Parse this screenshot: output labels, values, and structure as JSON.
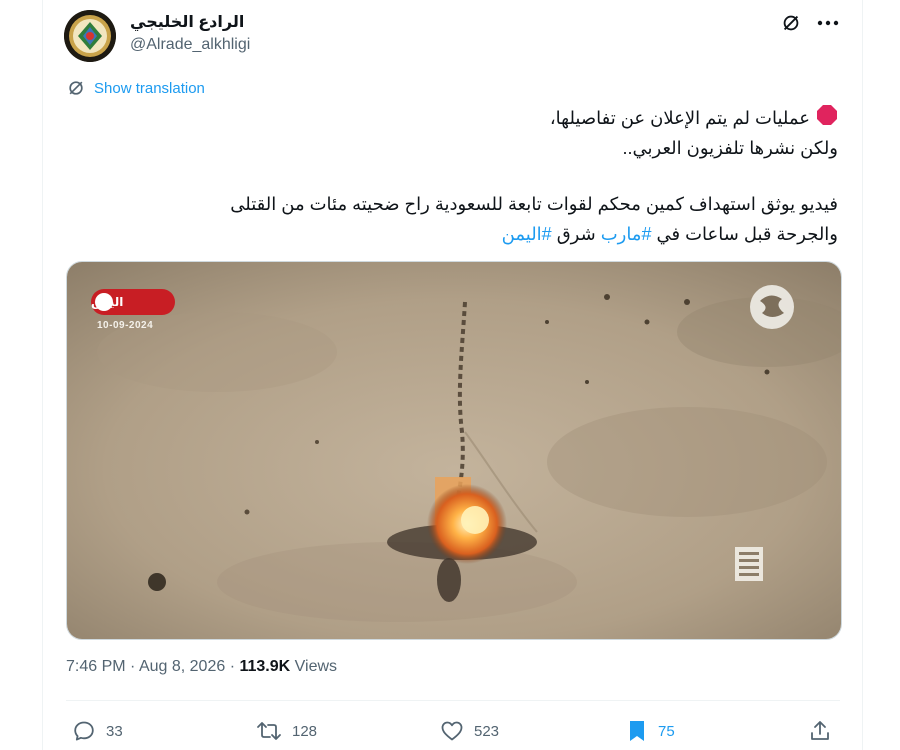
{
  "account": {
    "display_name": "الرادع الخليجي",
    "handle": "@Alrade_alkhligi",
    "avatar_icon": "gulf-emblem-icon"
  },
  "header_actions": [
    "grok-icon",
    "more-icon"
  ],
  "translation": {
    "label": "Show translation",
    "icon": "translate-icon"
  },
  "tweet": {
    "line1": "عمليات لم يتم الإعلان عن تفاصيلها،",
    "line1_icon": "red-octagon-emoji",
    "line2": "ولكن نشرها تلفزيون العربي..",
    "paragraph2_line1": "فيديو يوثق استهداف كمين محكم لقوات تابعة للسعودية راح ضحيته مئات من القتلى",
    "paragraph2_line2_text": "والجرحة قبل ساعات في ",
    "hashtag1": "#مارب",
    "middle_text": " شرق ",
    "hashtag2": "#اليمن"
  },
  "media": {
    "badge_label": "اليمن",
    "badge_date": "10-09-2024",
    "logo_icon": "channel-logo-icon",
    "corner_icon": "channel-corner-icon"
  },
  "meta": {
    "time": "7:46 PM",
    "separator": "·",
    "date": "Aug 8, 2026",
    "views_count": "113.9K",
    "views_label": "Views"
  },
  "actions": {
    "reply_count": "33",
    "retweet_count": "128",
    "like_count": "523",
    "bookmark_count": "75"
  },
  "colors": {
    "accent": "#1d9bf0",
    "text": "#0f1419",
    "muted": "#536471",
    "badge_red": "#c81e24"
  }
}
